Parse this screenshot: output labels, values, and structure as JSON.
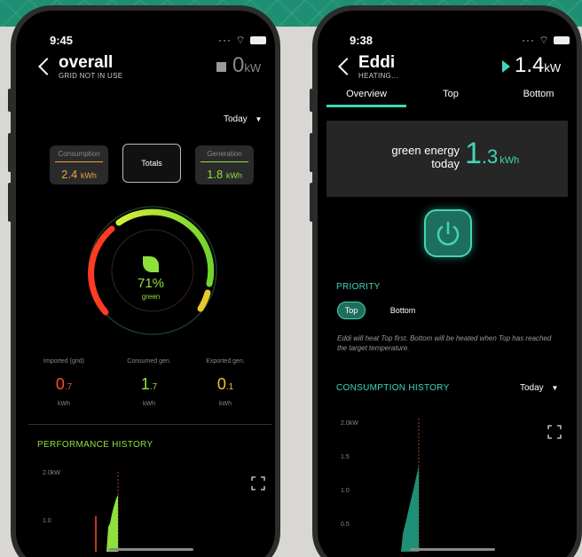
{
  "colors": {
    "accent": "#3fd6b8",
    "generation_green": "#8ee03c",
    "import_red": "#ff4a2a",
    "export_yellow": "#e8c82a",
    "consumption_orange": "#e8a53c"
  },
  "left": {
    "status": {
      "time": "9:45",
      "icons": "wifi battery"
    },
    "header": {
      "title": "overall",
      "subtitle": "GRID NOT IN USE",
      "power_value": "0",
      "power_unit": "kW"
    },
    "period": {
      "label": "Today"
    },
    "tabs": {
      "consumption": {
        "label": "Consumption",
        "value": "2.4",
        "unit": "kWh"
      },
      "totals": {
        "label": "Totals"
      },
      "generation": {
        "label": "Generation",
        "value": "1.8",
        "unit": "kWh"
      }
    },
    "gauge": {
      "percent": "71%",
      "caption": "green",
      "green_fraction": 0.71
    },
    "stats": [
      {
        "label": "Imported (grid)",
        "int": "0",
        "dec": ".7",
        "unit": "kWh"
      },
      {
        "label": "Consumed gen.",
        "int": "1",
        "dec": ".7",
        "unit": "kWh"
      },
      {
        "label": "Exported gen.",
        "int": "0",
        "dec": ".1",
        "unit": "kWh"
      }
    ],
    "history": {
      "title": "PERFORMANCE HISTORY",
      "y_ticks": [
        "2.0kW",
        "1.0"
      ]
    }
  },
  "right": {
    "status": {
      "time": "9:38"
    },
    "header": {
      "title": "Eddi",
      "subtitle": "HEATING...",
      "power_value": "1.4",
      "power_unit": "kW"
    },
    "tabs": [
      "Overview",
      "Top",
      "Bottom"
    ],
    "green_energy": {
      "line1": "green energy",
      "line2": "today",
      "int": "1",
      "dec": ".3",
      "unit": "kWh"
    },
    "priority": {
      "title": "PRIORITY",
      "options": [
        "Top",
        "Bottom"
      ],
      "selected": "Top",
      "note": "Eddi will heat Top first. Bottom will be heated when Top has reached the target temperature."
    },
    "history": {
      "title": "CONSUMPTION HISTORY",
      "period": "Today",
      "y_ticks": [
        "2.0kW",
        "1.5",
        "1.0",
        "0.5"
      ]
    }
  }
}
